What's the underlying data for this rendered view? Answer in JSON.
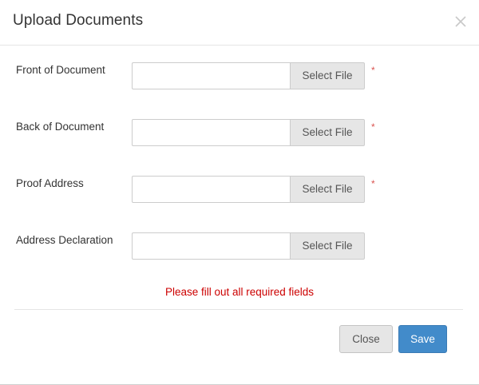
{
  "dialog": {
    "title": "Upload Documents",
    "close_icon": "close-icon"
  },
  "fields": [
    {
      "label": "Front of Document",
      "value": "",
      "button_label": "Select File",
      "required": true,
      "required_mark": "*"
    },
    {
      "label": "Back of Document",
      "value": "",
      "button_label": "Select File",
      "required": true,
      "required_mark": "*"
    },
    {
      "label": "Proof Address",
      "value": "",
      "button_label": "Select File",
      "required": true,
      "required_mark": "*"
    },
    {
      "label": "Address Declaration",
      "value": "",
      "button_label": "Select File",
      "required": false
    }
  ],
  "validation": {
    "message": "Please fill out all required fields"
  },
  "footer": {
    "close_label": "Close",
    "save_label": "Save"
  },
  "colors": {
    "required": "#d9534f",
    "error_text": "#cc0000",
    "primary_button": "#428bca",
    "default_button": "#e6e6e6"
  }
}
